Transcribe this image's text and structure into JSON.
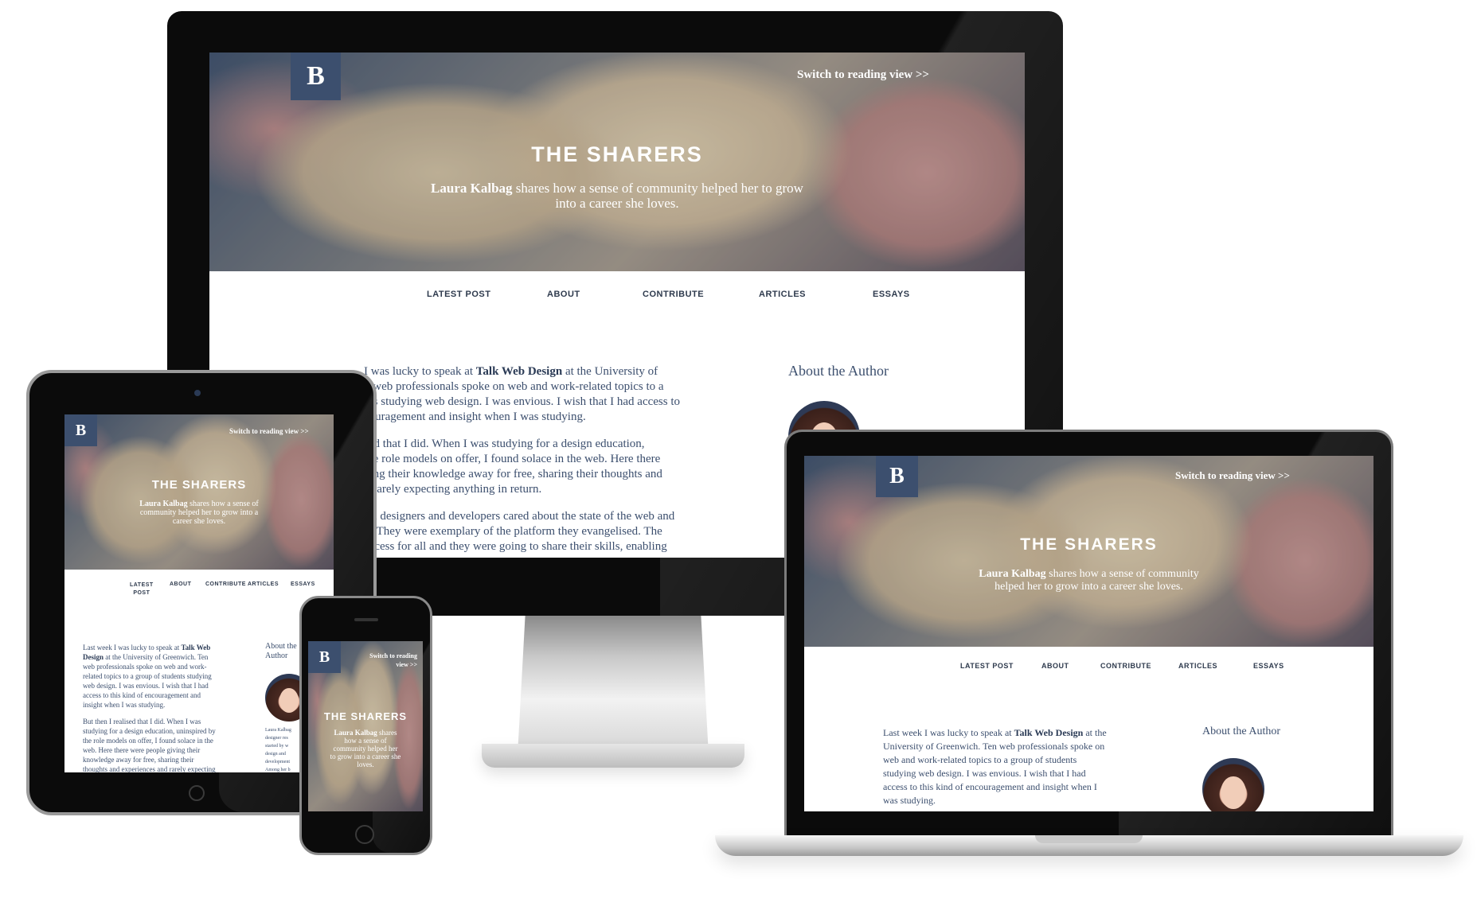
{
  "site": {
    "logo_letter": "B",
    "reading_view": "Switch to reading view >>",
    "reading_view_phone_1": "Switch to reading",
    "reading_view_phone_2": "view >>",
    "title": "THE SHARERS",
    "subtitle_name": "Laura Kalbag",
    "subtitle_rest": "shares how a sense of community helped her to grow into a career she loves.",
    "subtitle_rest_line1": "shares how a sense of community helped her to grow",
    "subtitle_rest_line2": "into a career she loves.",
    "nav": [
      "LATEST POST",
      "ABOUT",
      "CONTRIBUTE",
      "ARTICLES",
      "ESSAYS"
    ],
    "about_heading": "About the Author",
    "paragraphs": [
      {
        "lead": "Last week I was lucky to speak at",
        "strong": "Talk Web Design",
        "rest": "at the University of Greenwich. Ten web professionals spoke on web and work-related topics to a group of students studying web design. I was envious. I wish that I had access to this kind of encouragement and insight when I was studying."
      },
      {
        "text": "But then I realised that I did. When I was studying for a design education, uninspired by the role models on offer, I found solace in the web. Here there were people giving their knowledge away for free, sharing their thoughts and experiences and rarely expecting anything in return."
      },
      {
        "text": "These wonderful designers and developers cared about the state of the web and the people in it. They were exemplary of the platform they evangelised. The web offered access for all and they were going to share their skills, enabling"
      }
    ],
    "imac_body_lines": [
      {
        "text": "I was lucky to speak at ",
        "strong": "Talk Web Design",
        "tail": " at the University of"
      },
      {
        "text": "n web professionals spoke on web and work-related topics to a"
      },
      {
        "text": "nts studying web design. I was envious. I wish that I had access to"
      },
      {
        "text": "couragement and insight when I was studying."
      },
      {
        "text": ""
      },
      {
        "text": "sed that I did. When I was studying for a design education,"
      },
      {
        "text": "the role models on offer, I found solace in the web. Here there"
      },
      {
        "text": "ving their knowledge away for free, sharing their thoughts and"
      },
      {
        "text": "d rarely expecting anything in return."
      },
      {
        "text": ""
      },
      {
        "text": "ful designers and developers cared about the state of the web and"
      },
      {
        "text": "it. They were exemplary of the platform they evangelised. The"
      },
      {
        "text": "access for all and they were going to share their skills, enabling"
      }
    ],
    "laptop_body_lines": [
      {
        "text": "Last week I was lucky to speak at ",
        "strong": "Talk Web Design",
        "tail": " at the"
      },
      {
        "text": "University of Greenwich. Ten web professionals spoke on"
      },
      {
        "text": "web and work-related topics to a group of students"
      },
      {
        "text": "studying web design. I was envious. I wish that I had"
      },
      {
        "text": "access to this kind of encouragement and insight when I"
      },
      {
        "text": "was studying."
      }
    ],
    "tablet_body_lines": [
      {
        "text": "Last week I was lucky to speak at ",
        "strong": "Talk Web"
      },
      {
        "text": "",
        "strong": "Design",
        "tail": " at the University of Greenwich. Ten"
      },
      {
        "text": "web professionals spoke on web and work-"
      },
      {
        "text": "related topics to a group of students studying"
      },
      {
        "text": "web design. I was envious. I wish that I had"
      },
      {
        "text": "access to this kind of encouragement and"
      },
      {
        "text": "insight when I was studying."
      },
      {
        "text": ""
      },
      {
        "text": "But then I realised that I did. When I was"
      },
      {
        "text": "studying for a design education, uninspired by"
      },
      {
        "text": "the role models on offer, I found solace in the"
      },
      {
        "text": "web. Here there were people giving their"
      },
      {
        "text": "knowledge away for free, sharing their"
      },
      {
        "text": "thoughts and experiences and rarely expecting"
      }
    ],
    "tablet_about_1": "About the",
    "tablet_about_2": "Author",
    "tablet_nav_latest_1": "LATEST",
    "tablet_nav_latest_2": "POST",
    "tablet_sub_1": "shares how a sense of",
    "tablet_sub_2": "community helped her to grow into a",
    "tablet_sub_3": "career she loves.",
    "phone_sub_1": "shares",
    "phone_sub_2": "how a sense of",
    "phone_sub_3": "community helped her",
    "phone_sub_4": "to grow into a career she",
    "phone_sub_5": "loves.",
    "laptop_sub_1": "shares how a sense of community",
    "laptop_sub_2": "helped her to grow into a career she loves.",
    "tablet_side_text": [
      "Laura Kalbag",
      "designer res",
      "started by w",
      "design and",
      "development",
      "Among her b"
    ]
  },
  "colors": {
    "brand_navy": "#3c4f6e",
    "text_navy": "#2e3a4d",
    "bezel": "#0b0b0b"
  }
}
